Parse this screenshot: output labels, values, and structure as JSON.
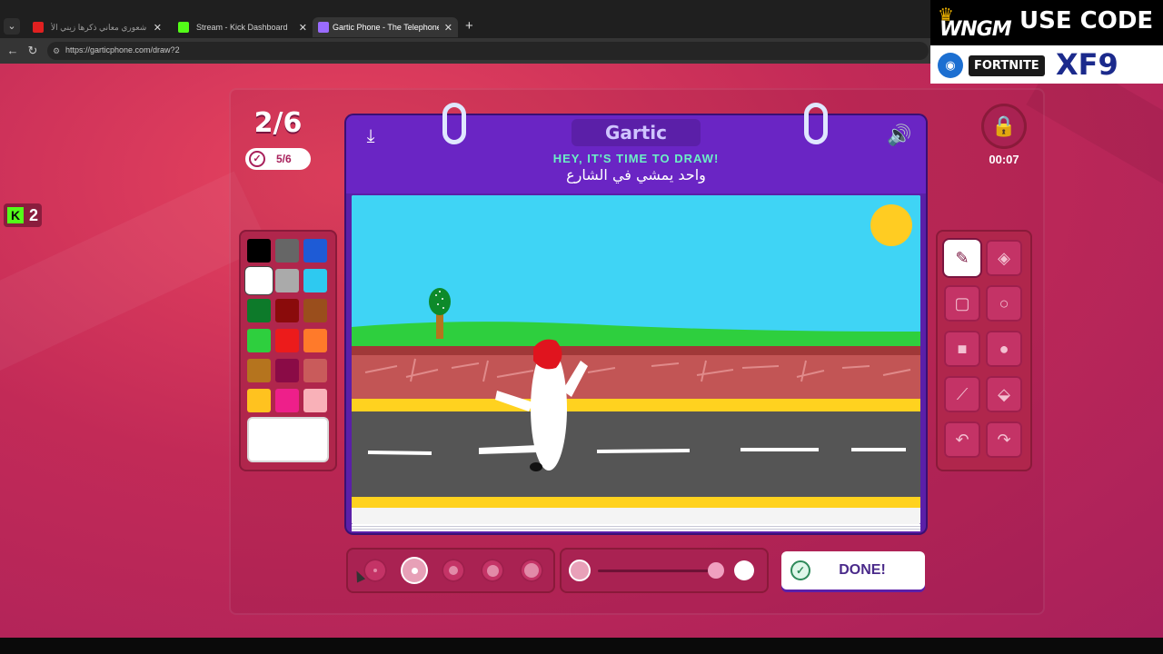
{
  "browser": {
    "tabs": [
      {
        "title": "هرت شعوري معاني ذكرها زيني الأ..."
      },
      {
        "title": "Stream - Kick Dashboard"
      },
      {
        "title": "Gartic Phone - The Telephone Gam..."
      }
    ],
    "url": "https://garticphone.com/draw?2"
  },
  "game": {
    "round": "2/6",
    "players_done": "5/6",
    "logo": "Gartic",
    "hint": "HEY, IT'S TIME TO DRAW!",
    "prompt": "واحد يمشي في الشارع",
    "timer": "00:07",
    "done_label": "DONE!",
    "palette": [
      "#000000",
      "#666666",
      "#1e5bd6",
      "#ffffff",
      "#aaaaaa",
      "#2ec9f0",
      "#0d7a2a",
      "#8a0b0b",
      "#9a4e1c",
      "#2ecf3e",
      "#ec1b1b",
      "#ff7a2a",
      "#b5741e",
      "#8a0b46",
      "#c95b5b",
      "#ffc21f",
      "#ee1f8a",
      "#f9b1b8"
    ],
    "selected_color": "#ffffff",
    "brush_sizes_count": 5,
    "selected_brush_index": 1,
    "opacity_percent": 100,
    "tools": [
      "pencil-icon",
      "eraser-icon",
      "square-outline-icon",
      "circle-outline-icon",
      "square-filled-icon",
      "circle-filled-icon",
      "line-icon",
      "bucket-icon",
      "undo-icon",
      "redo-icon"
    ],
    "selected_tool": "pencil-icon"
  },
  "kick_badge": {
    "count": "2"
  },
  "overlay": {
    "brand": "WNGM",
    "headline": "USE CODE",
    "game": "FORTNITE",
    "code": "XF9"
  }
}
